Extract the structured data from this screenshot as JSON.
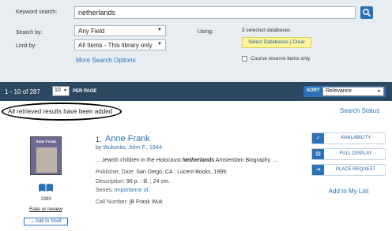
{
  "search": {
    "keyword_label": "Keyword search:",
    "keyword_value": "netherlands",
    "search_by_label": "Search by:",
    "search_by_value": "Any Field",
    "limit_by_label": "Limit by:",
    "limit_by_value": "All Items - This library only",
    "using_label": "Using:",
    "selected_db_count": "3 selected databases",
    "select_db_link": "Select Databases",
    "clear_link": "Clear",
    "db_separator": "|",
    "more_options": "More Search Options",
    "course_reserve_label": "Course reserve items only"
  },
  "results_bar": {
    "range": "1 - 10 of 287",
    "per_page_value": "10",
    "per_page_label": "PER PAGE",
    "sort_label": "SORT",
    "sort_value": "Relevance"
  },
  "notice": "All retrieved results have been added",
  "search_status": "Search Status",
  "result": {
    "number": "1.",
    "title": "Anne Frank",
    "by_label": "by",
    "author": "Wukovits, John F., 1944-",
    "snippet_pre": "... Jewish children in the Holocaust ",
    "snippet_em": "Netherlands",
    "snippet_post": " Amsterdam Biography. ...",
    "publisher_label": "Publisher, Date:",
    "publisher_value": "San Diego, CA : Lucent Books, 1999.",
    "description_label": "Description:",
    "description_value": "96 p. : ill. ; 24 cm.",
    "series_label": "Series:",
    "series_value": "Importance of.",
    "call_label": "Call Number:",
    "call_value": "jB Frank Wuk",
    "cover_title": "Anne Frank",
    "year": "1999",
    "rate_link": "Rate or review",
    "add_shelf": "Add to Shelf"
  },
  "actions": {
    "availability": "AVAILABILITY",
    "full_display": "FULL DISPLAY",
    "place_request": "PLACE REQUEST",
    "add_to_list": "Add to My List"
  },
  "colors": {
    "accent": "#2a72b5",
    "results_bar": "#2c4861",
    "search_panel": "#e8edf2",
    "db_highlight": "#fff59a"
  }
}
